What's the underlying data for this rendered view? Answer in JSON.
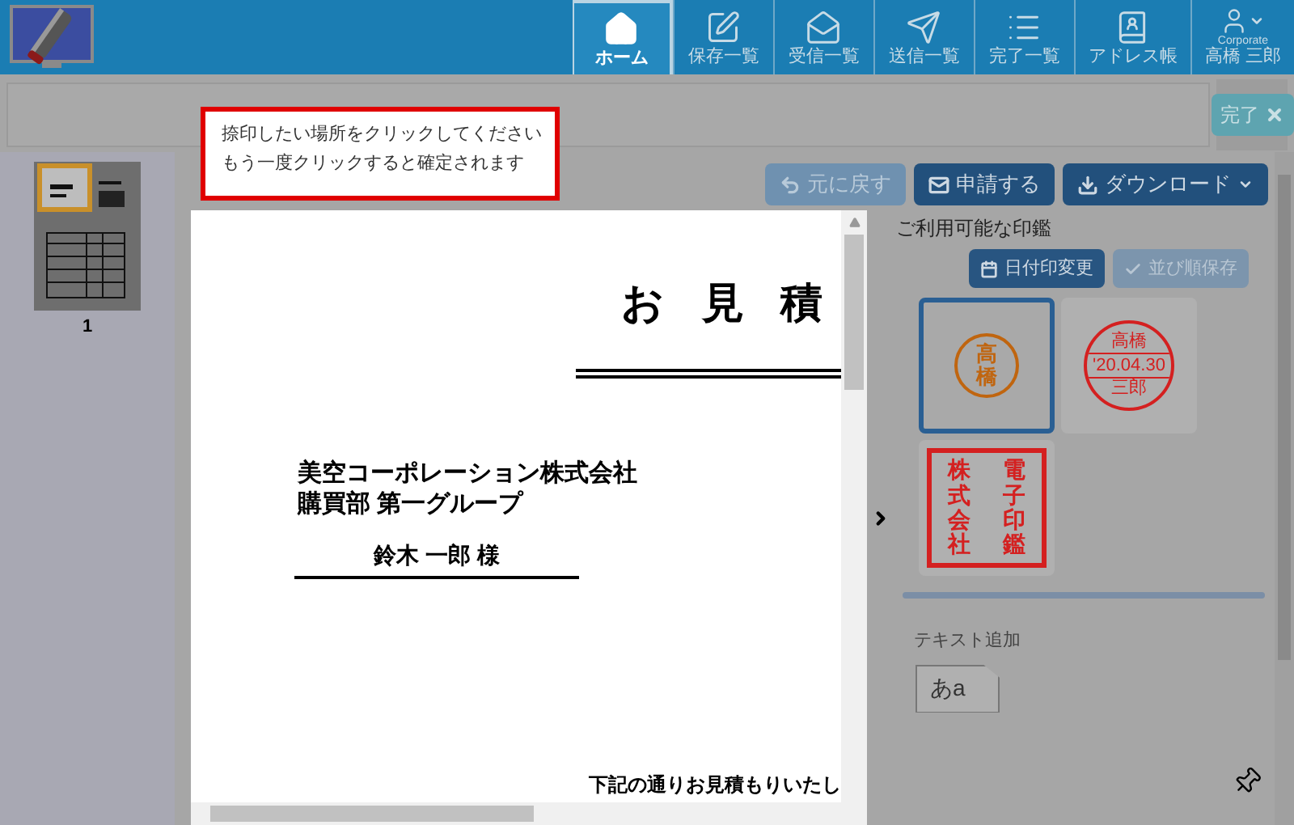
{
  "header": {
    "nav": [
      {
        "label": "ホーム",
        "selected": true
      },
      {
        "label": "保存一覧",
        "selected": false
      },
      {
        "label": "受信一覧",
        "selected": false
      },
      {
        "label": "送信一覧",
        "selected": false
      },
      {
        "label": "完了一覧",
        "selected": false
      },
      {
        "label": "アドレス帳",
        "selected": false
      }
    ],
    "user": {
      "caption": "Corporate",
      "name": "高橋 三郎"
    }
  },
  "toolbar": {
    "done_button": "完了"
  },
  "tooltip": {
    "lines": [
      "捺印したい場所をクリックしてください",
      "もう一度クリックすると確定されます"
    ]
  },
  "thumbnails": [
    {
      "page": "1",
      "selected": true
    }
  ],
  "actions": [
    {
      "label": "元に戻す",
      "disabled": true
    },
    {
      "label": "申請する",
      "disabled": false
    },
    {
      "label": "ダウンロード",
      "disabled": false
    }
  ],
  "document": {
    "title": "お 見 積",
    "company": "美空コーポレーション株式会社",
    "department": "購買部 第一グループ",
    "recipient": "鈴木 一郎 様",
    "note": "下記の通りお見積もりいたし"
  },
  "stamp_panel": {
    "heading": "ご利用可能な印鑑",
    "buttons": [
      {
        "label": "日付印変更",
        "disabled": false
      },
      {
        "label": "並び順保存",
        "disabled": true
      }
    ],
    "stamps": [
      {
        "kind": "round",
        "color": "#c0650f",
        "text": "高橋",
        "selected": true
      },
      {
        "kind": "date",
        "color": "#d42020",
        "top": "高橋",
        "date": "'20.04.30",
        "bottom": "三郎",
        "selected": false
      },
      {
        "kind": "square",
        "color": "#d42020",
        "columns": [
          "株式会社",
          "電子印鑑"
        ],
        "selected": false
      }
    ],
    "text_heading": "テキスト追加",
    "text_sample": "あa"
  }
}
